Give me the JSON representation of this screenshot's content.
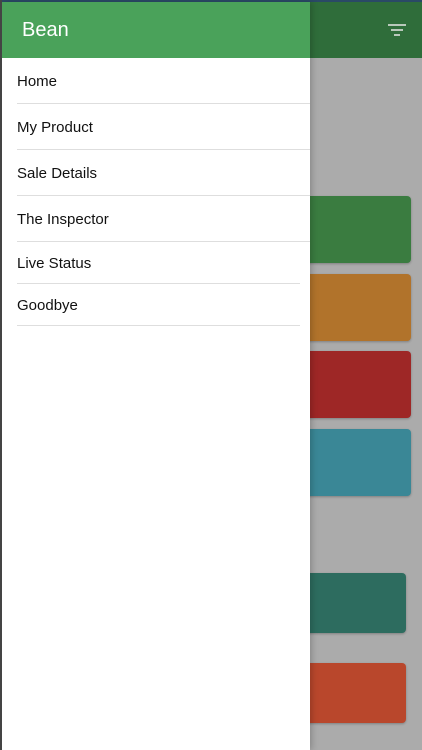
{
  "drawer": {
    "title": "Bean",
    "items": [
      {
        "label": "Home"
      },
      {
        "label": "My Product"
      },
      {
        "label": "Sale Details"
      },
      {
        "label": "The Inspector"
      },
      {
        "label": "Live Status"
      },
      {
        "label": "Goodbye"
      }
    ]
  },
  "background": {
    "header_color": "#2f6d3a",
    "header_icon": "filter-icon",
    "tiles": [
      {
        "color": "#3a7c40"
      },
      {
        "color": "#b1732b"
      },
      {
        "color": "#9e2726"
      },
      {
        "color": "#3a8796"
      },
      {
        "color": "#2d6c5f"
      },
      {
        "color": "#b9472c"
      }
    ]
  },
  "colors": {
    "drawer_header": "#4aa25a",
    "drawer_background": "#ffffff",
    "overlay": "#ababab"
  }
}
